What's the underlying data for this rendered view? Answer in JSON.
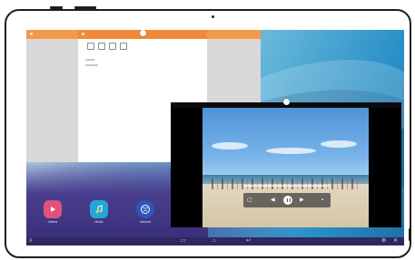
{
  "device": {
    "frame_color": "#1e1e1e"
  },
  "window_notes": {
    "title_bar_color": "#f29a4a",
    "toolbar": [
      {
        "icon": "text-icon",
        "label": ""
      },
      {
        "icon": "image-icon",
        "label": ""
      },
      {
        "icon": "mic-icon",
        "label": ""
      },
      {
        "icon": "list-icon",
        "label": ""
      }
    ]
  },
  "video_window": {
    "state": "playing"
  },
  "dock": {
    "apps": [
      {
        "icon": "video-play-icon",
        "label": "Videos",
        "color": "#e0527a"
      },
      {
        "icon": "music-note-icon",
        "label": "Music",
        "color": "#27a4d8"
      },
      {
        "icon": "browser-globe-icon",
        "label": "Internet",
        "color": "#2f56b8"
      }
    ]
  },
  "navbar": {
    "left_icon": "menu-icon",
    "center_icons": [
      "recents-icon",
      "home-icon",
      "back-icon"
    ],
    "right_icons": [
      "gear-icon",
      "close-icon"
    ]
  }
}
